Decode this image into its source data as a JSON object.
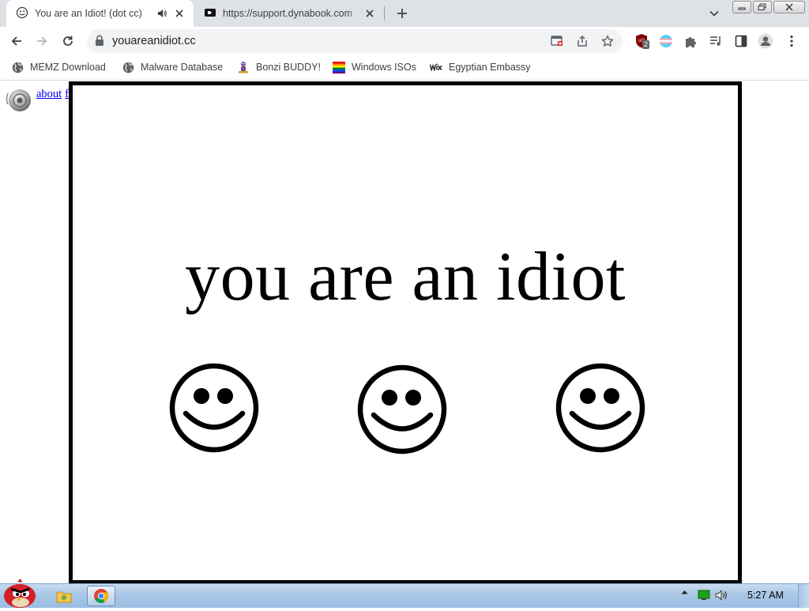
{
  "tabs": [
    {
      "title": "You are an Idiot! (dot cc)",
      "active": true,
      "icon": "smiley-icon",
      "muted_icon": "speaker-icon"
    },
    {
      "title": "https://support.dynabook.com",
      "active": false,
      "icon": "dynabook-icon"
    }
  ],
  "toolbar": {
    "url": "youareanidiot.cc",
    "extension_badge": "2"
  },
  "bookmarks": [
    {
      "label": "MEMZ Download",
      "icon": "globe-icon"
    },
    {
      "label": "Malware Database",
      "icon": "globe-icon"
    },
    {
      "label": "Bonzi BUDDY!",
      "icon": "bonzi-icon"
    },
    {
      "label": "Windows ISOs",
      "icon": "rainbow-flag-icon"
    },
    {
      "label": "Egyptian Embassy",
      "icon": "wix-icon"
    }
  ],
  "page": {
    "links": [
      "about",
      "flash"
    ],
    "headline": "you are an idiot",
    "smiley_count": 3
  },
  "taskbar": {
    "clock": "5:27 AM"
  },
  "colors": {
    "tab_strip": "#dee1e6",
    "omnibox": "#f1f3f4",
    "link": "#0000ee",
    "frame_border": "#000000",
    "taskbar": "#a9c6e6"
  }
}
